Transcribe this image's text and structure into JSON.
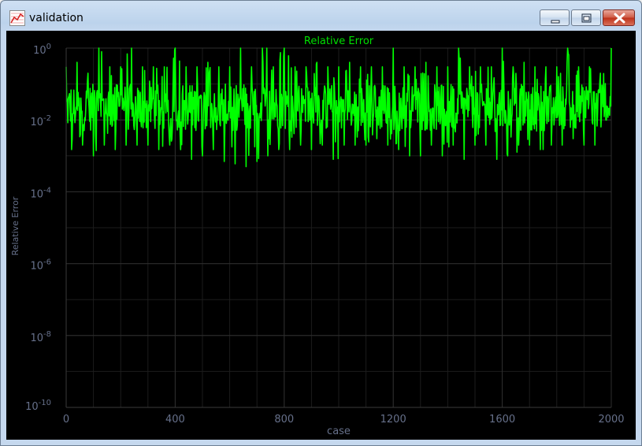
{
  "window": {
    "title": "validation",
    "icon": "chart-icon",
    "buttons": {
      "minimize": "minimize-icon",
      "maximize": "maximize-icon",
      "close": "close-icon"
    }
  },
  "colors": {
    "background": "#000000",
    "line": "#00ff00",
    "title": "#00e000",
    "axis_text": "#66708a",
    "grid": "#2e2e2e"
  },
  "chart_data": {
    "type": "line",
    "title": "Relative Error",
    "xlabel": "case",
    "ylabel": "Relative Error",
    "yscale": "log",
    "grid": true,
    "xlim": [
      0,
      2000
    ],
    "ylim": [
      1e-10,
      1
    ],
    "xticks": [
      0,
      400,
      800,
      1200,
      1600,
      2000
    ],
    "yticks": [
      {
        "base": "10",
        "exp": "0"
      },
      {
        "base": "10",
        "exp": "-2"
      },
      {
        "base": "10",
        "exp": "-4"
      },
      {
        "base": "10",
        "exp": "-6"
      },
      {
        "base": "10",
        "exp": "-8"
      },
      {
        "base": "10",
        "exp": "-10"
      }
    ],
    "series": [
      {
        "color": "#00ff00",
        "x": [
          0,
          40,
          80,
          120,
          160,
          200,
          240,
          280,
          320,
          360,
          400,
          440,
          480,
          520,
          560,
          600,
          640,
          680,
          720,
          760,
          800,
          840,
          880,
          920,
          960,
          1000,
          1040,
          1080,
          1120,
          1160,
          1200,
          1240,
          1280,
          1320,
          1360,
          1400,
          1440,
          1480,
          1520,
          1560,
          1600,
          1640,
          1680,
          1720,
          1760,
          1800,
          1840,
          1880,
          1920,
          1960,
          2000
        ],
        "upper": [
          0.3,
          0.4,
          0.2,
          1.0,
          0.3,
          0.3,
          1.0,
          0.3,
          0.3,
          0.3,
          1.0,
          0.3,
          0.3,
          0.4,
          0.3,
          0.3,
          1.0,
          0.3,
          1.0,
          0.3,
          1.0,
          0.3,
          0.3,
          0.4,
          0.3,
          0.3,
          0.4,
          0.3,
          0.3,
          0.3,
          1.0,
          0.3,
          0.3,
          0.4,
          0.3,
          0.3,
          1.0,
          0.3,
          0.3,
          0.3,
          1.0,
          0.3,
          0.4,
          0.3,
          0.3,
          0.3,
          1.0,
          0.3,
          0.3,
          0.2,
          1.0
        ],
        "lower": [
          0.003,
          0.0015,
          0.002,
          0.001,
          0.002,
          0.0015,
          0.002,
          0.002,
          0.002,
          0.0015,
          0.002,
          0.0015,
          0.0008,
          0.001,
          0.0015,
          0.0007,
          0.0006,
          0.0005,
          0.0007,
          0.001,
          0.0015,
          0.0015,
          0.002,
          0.0015,
          0.002,
          0.0008,
          0.002,
          0.002,
          0.002,
          0.003,
          0.002,
          0.0015,
          0.001,
          0.001,
          0.002,
          0.001,
          0.002,
          0.0008,
          0.002,
          0.002,
          0.0008,
          0.001,
          0.002,
          0.002,
          0.0015,
          0.002,
          0.002,
          0.003,
          0.002,
          0.002,
          0.01
        ],
        "typical_band": [
          0.005,
          0.1
        ]
      }
    ]
  }
}
